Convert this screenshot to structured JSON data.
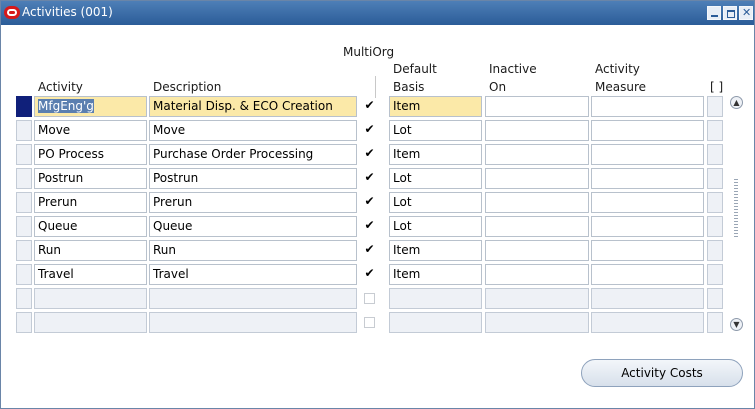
{
  "window": {
    "title": "Activities (001)",
    "icons": {
      "app": "oracle-logo-icon",
      "minimize": "minimize-icon",
      "maximize": "maximize-icon",
      "close": "close-icon"
    }
  },
  "headers": {
    "multiorg": "MultiOrg",
    "activity": "Activity",
    "description": "Description",
    "default_basis_1": "Default",
    "default_basis_2": "Basis",
    "inactive_1": "Inactive",
    "inactive_2": "On",
    "measure_1": "Activity",
    "measure_2": "Measure",
    "flex": "[ ]"
  },
  "rows": [
    {
      "activity": "MfgEng'g",
      "description": "Material Disp. & ECO Creation",
      "multiorg": "✔",
      "basis": "Item",
      "inactive_on": "",
      "measure": ""
    },
    {
      "activity": "Move",
      "description": "Move",
      "multiorg": "✔",
      "basis": "Lot",
      "inactive_on": "",
      "measure": ""
    },
    {
      "activity": "PO Process",
      "description": "Purchase Order Processing",
      "multiorg": "✔",
      "basis": "Item",
      "inactive_on": "",
      "measure": ""
    },
    {
      "activity": "Postrun",
      "description": "Postrun",
      "multiorg": "✔",
      "basis": "Lot",
      "inactive_on": "",
      "measure": ""
    },
    {
      "activity": "Prerun",
      "description": "Prerun",
      "multiorg": "✔",
      "basis": "Lot",
      "inactive_on": "",
      "measure": ""
    },
    {
      "activity": "Queue",
      "description": "Queue",
      "multiorg": "✔",
      "basis": "Lot",
      "inactive_on": "",
      "measure": ""
    },
    {
      "activity": "Run",
      "description": "Run",
      "multiorg": "✔",
      "basis": "Item",
      "inactive_on": "",
      "measure": ""
    },
    {
      "activity": "Travel",
      "description": "Travel",
      "multiorg": "✔",
      "basis": "Item",
      "inactive_on": "",
      "measure": ""
    }
  ],
  "buttons": {
    "activity_costs": "Activity Costs"
  },
  "scrollbar": {
    "up": "scroll-up-icon",
    "down": "scroll-down-icon"
  },
  "colors": {
    "titlebar": "#2b5c98",
    "current_field": "#fbe9a8",
    "current_record": "#10207a"
  }
}
